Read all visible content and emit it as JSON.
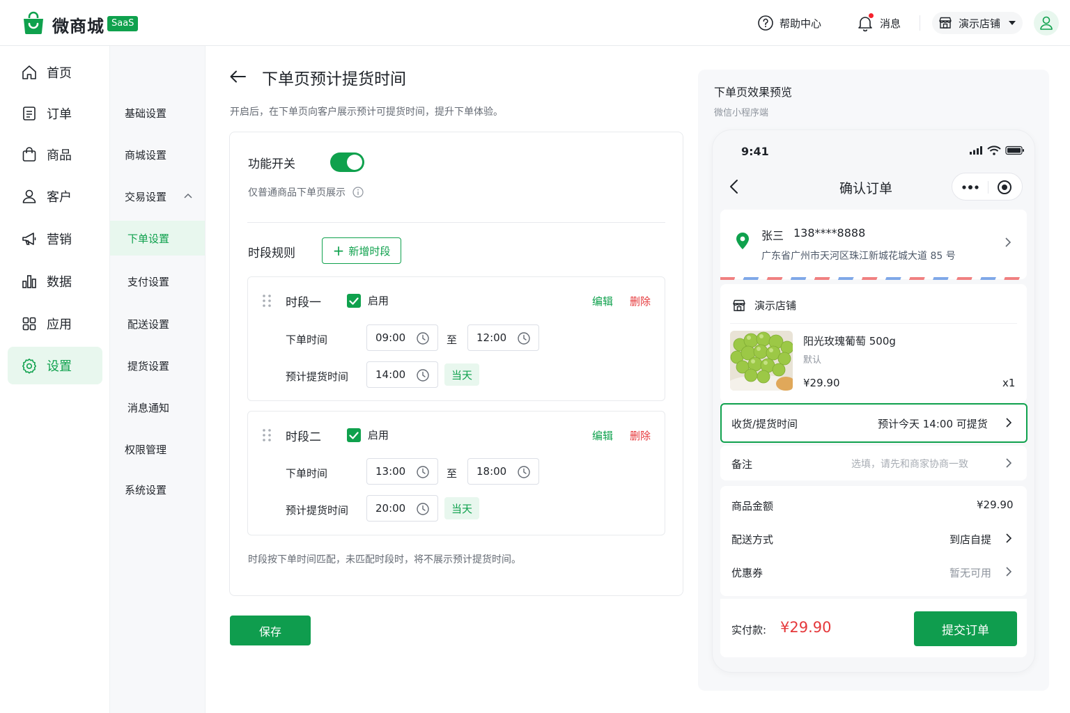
{
  "header": {
    "brand": "微商城",
    "badge": "SaaS",
    "help": "帮助中心",
    "messages": "消息",
    "store": "演示店铺"
  },
  "nav_primary": [
    {
      "label": "首页",
      "icon": "home-icon"
    },
    {
      "label": "订单",
      "icon": "order-icon"
    },
    {
      "label": "商品",
      "icon": "bag-icon"
    },
    {
      "label": "客户",
      "icon": "user-icon"
    },
    {
      "label": "营销",
      "icon": "megaphone-icon"
    },
    {
      "label": "数据",
      "icon": "bar-chart-icon"
    },
    {
      "label": "应用",
      "icon": "grid-icon"
    },
    {
      "label": "设置",
      "icon": "gear-icon",
      "active": true
    }
  ],
  "nav_secondary": [
    {
      "label": "基础设置"
    },
    {
      "label": "商城设置"
    },
    {
      "label": "交易设置",
      "expanded": true
    },
    {
      "label": "下单设置",
      "active": true
    },
    {
      "label": "支付设置"
    },
    {
      "label": "配送设置"
    },
    {
      "label": "提货设置"
    },
    {
      "label": "消息通知"
    },
    {
      "label": "权限管理"
    },
    {
      "label": "系统设置"
    }
  ],
  "main": {
    "title": "下单页预计提货时间",
    "description": "开启后，在下单页向客户展示预计可提货时间，提升下单体验。",
    "switch_label": "功能开关",
    "switch_on": true,
    "switch_hint": "仅普通商品下单页展示",
    "rules_label": "时段规则",
    "add_button": "新增时段",
    "periods": [
      {
        "name": "时段一",
        "enabled_label": "启用",
        "edit": "编辑",
        "delete": "删除",
        "order_time_label": "下单时间",
        "start": "09:00",
        "to": "至",
        "end": "12:00",
        "pickup_label": "预计提货时间",
        "pickup": "14:00",
        "day": "当天"
      },
      {
        "name": "时段二",
        "enabled_label": "启用",
        "edit": "编辑",
        "delete": "删除",
        "order_time_label": "下单时间",
        "start": "13:00",
        "to": "至",
        "end": "18:00",
        "pickup_label": "预计提货时间",
        "pickup": "20:00",
        "day": "当天"
      }
    ],
    "footnote": "时段按下单时间匹配，未匹配时段时，将不展示预计提货时间。",
    "save": "保存"
  },
  "preview": {
    "title": "下单页效果预览",
    "subtitle": "微信小程序端",
    "phone": {
      "time": "9:41",
      "page_title": "确认订单",
      "address": {
        "name": "张三",
        "phone": "138****8888",
        "detail": "广东省广州市天河区珠江新城花城大道 85 号"
      },
      "shop": "演示店铺",
      "product": {
        "name": "阳光玫瑰葡萄 500g",
        "spec": "默认",
        "price": "¥29.90",
        "qty": "x1"
      },
      "pickup_label": "收货/提货时间",
      "pickup_value": "预计今天 14:00 可提货",
      "remark_label": "备注",
      "remark_placeholder": "选填，请先和商家协商一致",
      "amount_label": "商品金额",
      "amount_value": "¥29.90",
      "delivery_label": "配送方式",
      "delivery_value": "到店自提",
      "coupon_label": "优惠券",
      "coupon_value": "暂无可用",
      "pay_label": "实付款:",
      "pay_amount": "¥29.90",
      "submit": "提交订单"
    }
  },
  "colors": {
    "primary": "#0fa14d",
    "danger": "#e5383b",
    "active_bg": "#e8f7ee"
  }
}
